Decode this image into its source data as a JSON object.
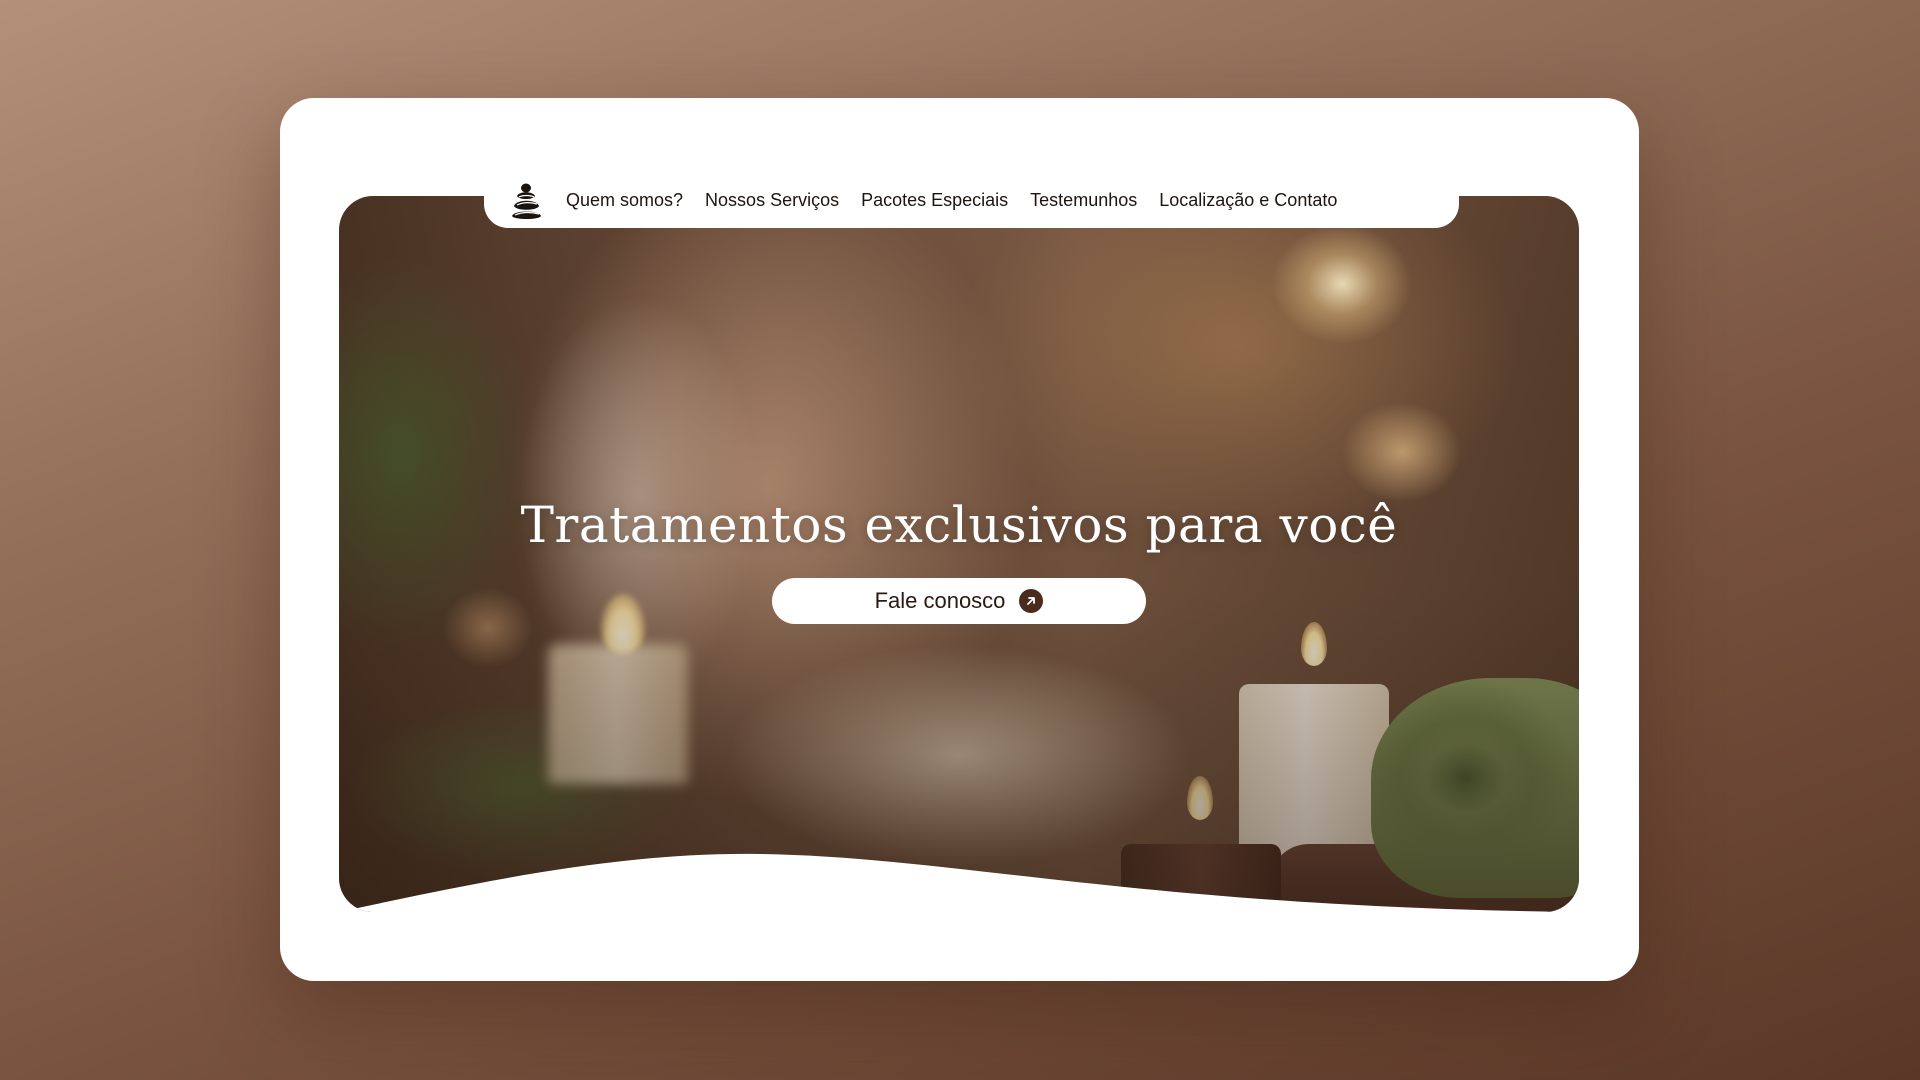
{
  "nav": {
    "logo_icon": "stacked-stones-icon",
    "items": [
      {
        "label": "Quem somos?"
      },
      {
        "label": "Nossos Serviços"
      },
      {
        "label": "Pacotes Especiais"
      },
      {
        "label": "Testemunhos"
      },
      {
        "label": "Localização e Contato"
      }
    ]
  },
  "hero": {
    "title": "Tratamentos exclusivos para você",
    "cta_label": "Fale conosco",
    "cta_icon": "arrow-up-right-icon"
  },
  "colors": {
    "page_background": "#8a6450",
    "card": "#ffffff",
    "accent_brown": "#4a2c1e",
    "text_dark": "#1e1410"
  }
}
